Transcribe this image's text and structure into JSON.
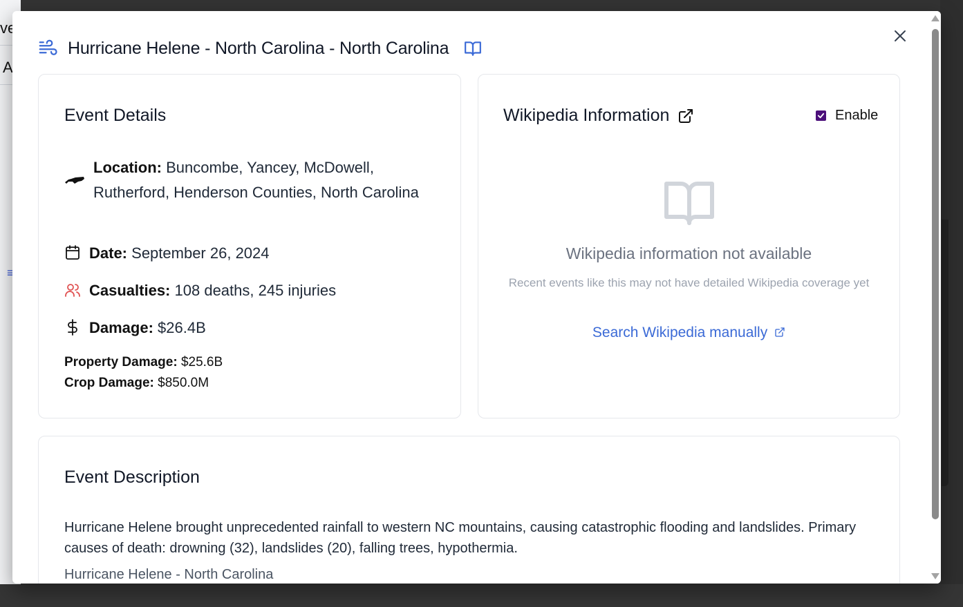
{
  "background": {
    "peek_text_1": "ve",
    "peek_text_2": "A"
  },
  "modal": {
    "title": "Hurricane Helene - North Carolina - North Carolina",
    "title_icon": "wind-icon",
    "book_icon": "book-open-icon",
    "close_icon": "close-icon",
    "accent_color": "#3b6ad6"
  },
  "event_details": {
    "heading": "Event Details",
    "location_label": "Location:",
    "location_value": "Buncombe, Yancey, McDowell, Rutherford, Henderson Counties, North Carolina",
    "date_label": "Date:",
    "date_value": "September 26, 2024",
    "casualties_label": "Casualties:",
    "casualties_value": "108 deaths, 245 injuries",
    "damage_label": "Damage:",
    "damage_value": "$26.4B",
    "property_label": "Property Damage:",
    "property_value": "$25.6B",
    "crop_label": "Crop Damage:",
    "crop_value": "$850.0M"
  },
  "wikipedia": {
    "heading": "Wikipedia Information",
    "enable_label": "Enable",
    "enable_checked": true,
    "unavailable_title": "Wikipedia information not available",
    "unavailable_sub": "Recent events like this may not have detailed Wikipedia coverage yet",
    "search_link": "Search Wikipedia manually"
  },
  "description": {
    "heading": "Event Description",
    "text": "Hurricane Helene brought unprecedented rainfall to western NC mountains, causing catastrophic flooding and landslides. Primary causes of death: drowning (32), landslides (20), falling trees, hypothermia.",
    "event_name": "Hurricane Helene - North Carolina"
  }
}
